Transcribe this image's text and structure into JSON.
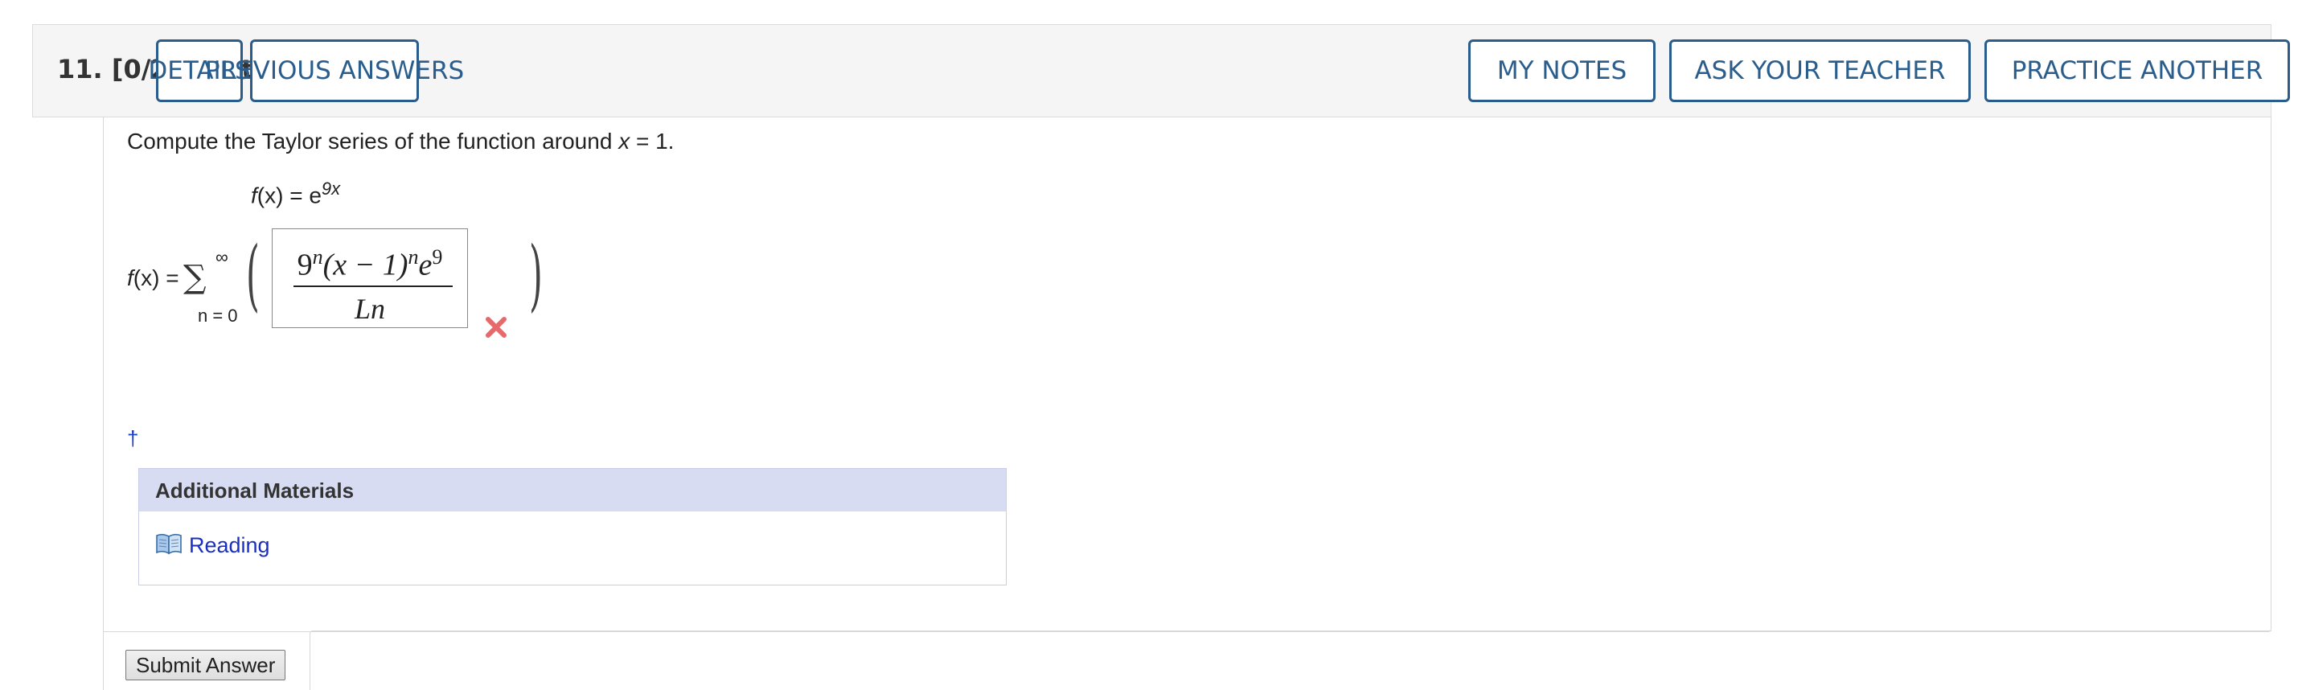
{
  "header": {
    "question_number": "11.",
    "points": "[0/2 Points]",
    "buttons": {
      "details": "DETAILS",
      "previous_answers": "PREVIOUS ANSWERS",
      "my_notes": "MY NOTES",
      "ask_teacher": "ASK YOUR TEACHER",
      "practice_another": "PRACTICE ANOTHER"
    }
  },
  "question": {
    "prompt_before": "Compute the Taylor series of the function around ",
    "prompt_var": "x",
    "prompt_after": " = 1.",
    "function_lhs_f": "f",
    "function_lhs_arg": "(x)",
    "function_eq": " = e",
    "function_exponent": "9x",
    "series_lhs_f": "f",
    "series_lhs_rest": "(x) =",
    "sum_symbol": "∑",
    "sum_upper": "∞",
    "sum_lower": "n = 0"
  },
  "answer": {
    "numerator_base": "9",
    "numerator_exp1": "n",
    "numerator_mid": "(x − 1)",
    "numerator_exp2": "n",
    "numerator_e": "e",
    "numerator_exp3": "9",
    "denominator": "Ln",
    "status": "incorrect",
    "status_color": "#e8696b"
  },
  "footnote_marker": "†",
  "additional_materials": {
    "title": "Additional Materials",
    "link_icon": "book-icon",
    "link_label": "Reading"
  },
  "submit_label": "Submit Answer",
  "colors": {
    "header_bg": "#f5f5f5",
    "button_border": "#2a5d8c",
    "link": "#1a2fbf",
    "materials_header_bg": "#d8dcf3"
  }
}
